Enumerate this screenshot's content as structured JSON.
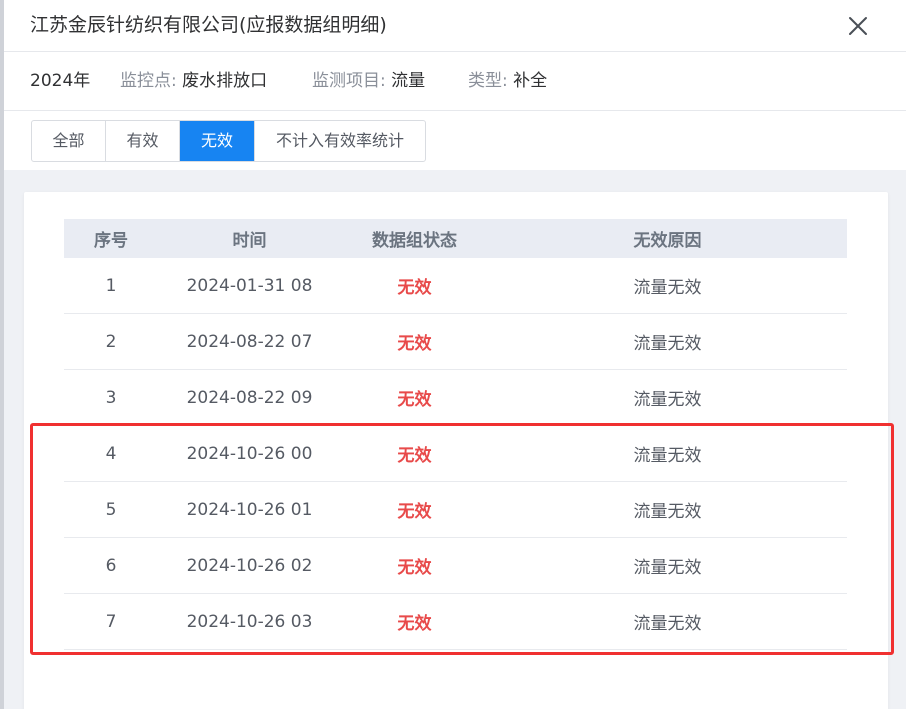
{
  "dialog": {
    "title": "江苏金辰针纺织有限公司(应报数据组明细)"
  },
  "info": {
    "year": "2024年",
    "monitor_point_label": "监控点:",
    "monitor_point_value": "废水排放口",
    "monitor_item_label": "监测项目:",
    "monitor_item_value": "流量",
    "type_label": "类型:",
    "type_value": "补全"
  },
  "tabs": [
    {
      "label": "全部",
      "active": false
    },
    {
      "label": "有效",
      "active": false
    },
    {
      "label": "无效",
      "active": true
    },
    {
      "label": "不计入有效率统计",
      "active": false
    }
  ],
  "table": {
    "columns": [
      "序号",
      "时间",
      "数据组状态",
      "无效原因"
    ],
    "rows": [
      {
        "index": "1",
        "time": "2024-01-31 08",
        "status": "无效",
        "reason": "流量无效"
      },
      {
        "index": "2",
        "time": "2024-08-22 07",
        "status": "无效",
        "reason": "流量无效"
      },
      {
        "index": "3",
        "time": "2024-08-22 09",
        "status": "无效",
        "reason": "流量无效"
      },
      {
        "index": "4",
        "time": "2024-10-26 00",
        "status": "无效",
        "reason": "流量无效"
      },
      {
        "index": "5",
        "time": "2024-10-26 01",
        "status": "无效",
        "reason": "流量无效"
      },
      {
        "index": "6",
        "time": "2024-10-26 02",
        "status": "无效",
        "reason": "流量无效"
      },
      {
        "index": "7",
        "time": "2024-10-26 03",
        "status": "无效",
        "reason": "流量无效"
      }
    ]
  },
  "colors": {
    "accent": "#1784f2",
    "invalid_status": "#e84a4a",
    "highlight_annotation": "#f03030"
  },
  "icons": {
    "close": "close-icon"
  }
}
